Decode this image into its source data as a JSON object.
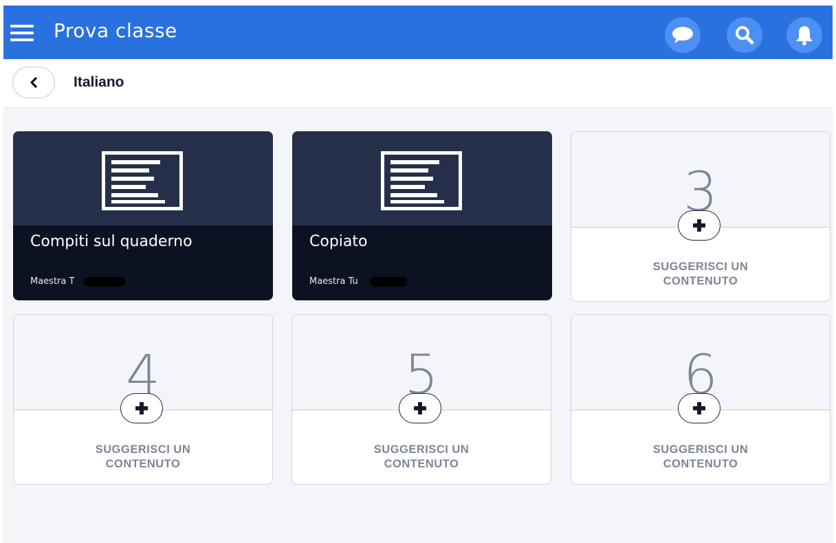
{
  "header": {
    "title": "Prova classe",
    "icons": [
      "menu-icon",
      "chat-icon",
      "search-icon",
      "bell-icon"
    ]
  },
  "subheader": {
    "title": "Italiano"
  },
  "cards": [
    {
      "type": "content",
      "title": "Compiti sul quaderno",
      "author": "Maestra T"
    },
    {
      "type": "content",
      "title": "Copiato",
      "author": "Maestra Tu"
    },
    {
      "type": "empty",
      "number": "3",
      "label": "SUGGERISCI UN\nCONTENUTO"
    },
    {
      "type": "empty",
      "number": "4",
      "label": "SUGGERISCI UN\nCONTENUTO"
    },
    {
      "type": "empty",
      "number": "5",
      "label": "SUGGERISCI UN\nCONTENUTO"
    },
    {
      "type": "empty",
      "number": "6",
      "label": "SUGGERISCI UN\nCONTENUTO"
    }
  ],
  "colors": {
    "header_bg": "#2a71e0",
    "card_dark": "#0c1222",
    "card_cover": "#262f4a",
    "page_bg": "#f3f5f9"
  }
}
